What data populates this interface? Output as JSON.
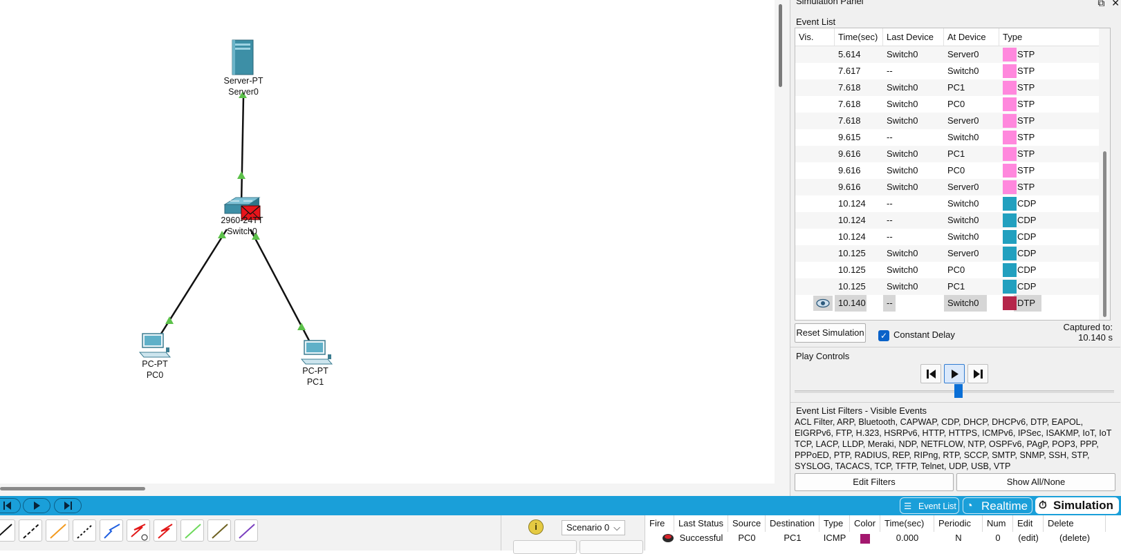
{
  "workspace": {
    "devices": [
      {
        "id": "server0",
        "model": "Server-PT",
        "name": "Server0"
      },
      {
        "id": "switch0",
        "model": "2960-24TT",
        "name": "Switch0"
      },
      {
        "id": "pc0",
        "model": "PC-PT",
        "name": "PC0"
      },
      {
        "id": "pc1",
        "model": "PC-PT",
        "name": "PC1"
      }
    ]
  },
  "sim_panel": {
    "title": "Simulation Panel",
    "event_list_label": "Event List",
    "columns": [
      "Vis.",
      "Time(sec)",
      "Last Device",
      "At Device",
      "Type"
    ],
    "events": [
      {
        "time": "5.614",
        "last": "Switch0",
        "at": "Server0",
        "type": "STP",
        "color": "#ff88dd"
      },
      {
        "time": "7.617",
        "last": "--",
        "at": "Switch0",
        "type": "STP",
        "color": "#ff88dd"
      },
      {
        "time": "7.618",
        "last": "Switch0",
        "at": "PC1",
        "type": "STP",
        "color": "#ff88dd"
      },
      {
        "time": "7.618",
        "last": "Switch0",
        "at": "PC0",
        "type": "STP",
        "color": "#ff88dd"
      },
      {
        "time": "7.618",
        "last": "Switch0",
        "at": "Server0",
        "type": "STP",
        "color": "#ff88dd"
      },
      {
        "time": "9.615",
        "last": "--",
        "at": "Switch0",
        "type": "STP",
        "color": "#ff88dd"
      },
      {
        "time": "9.616",
        "last": "Switch0",
        "at": "PC1",
        "type": "STP",
        "color": "#ff88dd"
      },
      {
        "time": "9.616",
        "last": "Switch0",
        "at": "PC0",
        "type": "STP",
        "color": "#ff88dd"
      },
      {
        "time": "9.616",
        "last": "Switch0",
        "at": "Server0",
        "type": "STP",
        "color": "#ff88dd"
      },
      {
        "time": "10.124",
        "last": "--",
        "at": "Switch0",
        "type": "CDP",
        "color": "#22a0bf"
      },
      {
        "time": "10.124",
        "last": "--",
        "at": "Switch0",
        "type": "CDP",
        "color": "#22a0bf"
      },
      {
        "time": "10.124",
        "last": "--",
        "at": "Switch0",
        "type": "CDP",
        "color": "#22a0bf"
      },
      {
        "time": "10.125",
        "last": "Switch0",
        "at": "Server0",
        "type": "CDP",
        "color": "#22a0bf"
      },
      {
        "time": "10.125",
        "last": "Switch0",
        "at": "PC0",
        "type": "CDP",
        "color": "#22a0bf"
      },
      {
        "time": "10.125",
        "last": "Switch0",
        "at": "PC1",
        "type": "CDP",
        "color": "#22a0bf"
      },
      {
        "time": "10.140",
        "last": "--",
        "at": "Switch0",
        "type": "DTP",
        "color": "#b5264a",
        "selected": true
      }
    ],
    "reset_label": "Reset Simulation",
    "constant_delay_label": "Constant Delay",
    "constant_delay_checked": true,
    "captured_label": "Captured to:",
    "captured_value": "10.140 s",
    "play_controls_label": "Play Controls",
    "filters_label": "Event List Filters - Visible Events",
    "filters_lines": [
      "ACL Filter, ARP, Bluetooth, CAPWAP, CDP, DHCP, DHCPv6, DTP, EAPOL,",
      "EIGRPv6, FTP, H.323, HSRPv6, HTTP, HTTPS, ICMPv6, IPSec, ISAKMP, IoT, IoT",
      "TCP, LACP, LLDP, Meraki, NDP, NETFLOW, NTP, OSPFv6, PAgP, POP3, PPP,",
      "PPPoED, PTP, RADIUS, REP, RIPng, RTP, SCCP, SMTP, SNMP, SSH, STP,",
      "SYSLOG, TACACS, TCP, TFTP, Telnet, UDP, USB, VTP"
    ],
    "edit_filters_label": "Edit Filters",
    "show_all_label": "Show All/None"
  },
  "mode_bar": {
    "event_list_tab": "Event List",
    "realtime_tab": "Realtime",
    "simulation_tab": "Simulation"
  },
  "scenario": {
    "selected": "Scenario 0"
  },
  "pdu_table": {
    "columns": [
      "Fire",
      "Last Status",
      "Source",
      "Destination",
      "Type",
      "Color",
      "Time(sec)",
      "Periodic",
      "Num",
      "Edit",
      "Delete"
    ],
    "rows": [
      {
        "status": "Successful",
        "source": "PC0",
        "destination": "PC1",
        "type": "ICMP",
        "color": "#a3176e",
        "time": "0.000",
        "periodic": "N",
        "num": "0",
        "edit": "(edit)",
        "delete": "(delete)"
      }
    ]
  },
  "icons": {
    "eye": "eye-icon",
    "envelope": "envelope-icon",
    "info": "info-icon"
  }
}
